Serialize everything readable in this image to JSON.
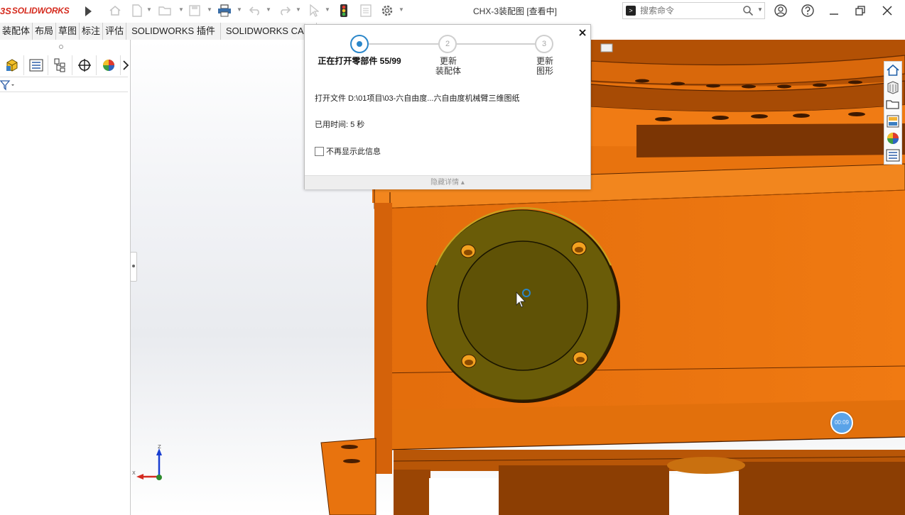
{
  "app": {
    "logo_prefix": "3S",
    "logo_name": "SOLIDWORKS",
    "document_title": "CHX-3装配图 [查看中]"
  },
  "toolbar": {
    "icons": [
      "home-icon",
      "new-file-icon",
      "open-file-icon",
      "save-icon",
      "print-icon",
      "undo-icon",
      "redo-icon",
      "select-icon",
      "rebuild-traffic-light-icon",
      "file-properties-icon",
      "options-gear-icon"
    ]
  },
  "search": {
    "placeholder": "搜索命令"
  },
  "tabs": [
    "装配体",
    "布局",
    "草图",
    "标注",
    "评估",
    "SOLIDWORKS 插件",
    "SOLIDWORKS CAM"
  ],
  "feature_manager": {
    "tab_icons": [
      "feature-tree-icon",
      "property-manager-icon",
      "configuration-manager-icon",
      "dimxpert-icon",
      "display-manager-icon"
    ]
  },
  "dialog": {
    "steps": [
      {
        "number": "",
        "label": "正在打开零部件 55/99",
        "active": true
      },
      {
        "number": "2",
        "label": "更新\n装配体",
        "active": false
      },
      {
        "number": "3",
        "label": "更新\n图形",
        "active": false
      }
    ],
    "file_line": "打开文件 D:\\01项目\\03-六自由度...六自由度机械臂三维图纸",
    "elapsed_line": "已用时间:  5 秒",
    "dont_show_label": "不再显示此信息",
    "footer_label": "隐藏详情"
  },
  "viewport": {
    "triad_labels": {
      "z": "Z",
      "x": "X"
    },
    "timer_badge": "00:09"
  },
  "colors": {
    "accent_blue": "#2a86c9",
    "model_orange": "#e8730e",
    "flange_olive": "#665a05",
    "brand_red": "#d52b1e"
  }
}
